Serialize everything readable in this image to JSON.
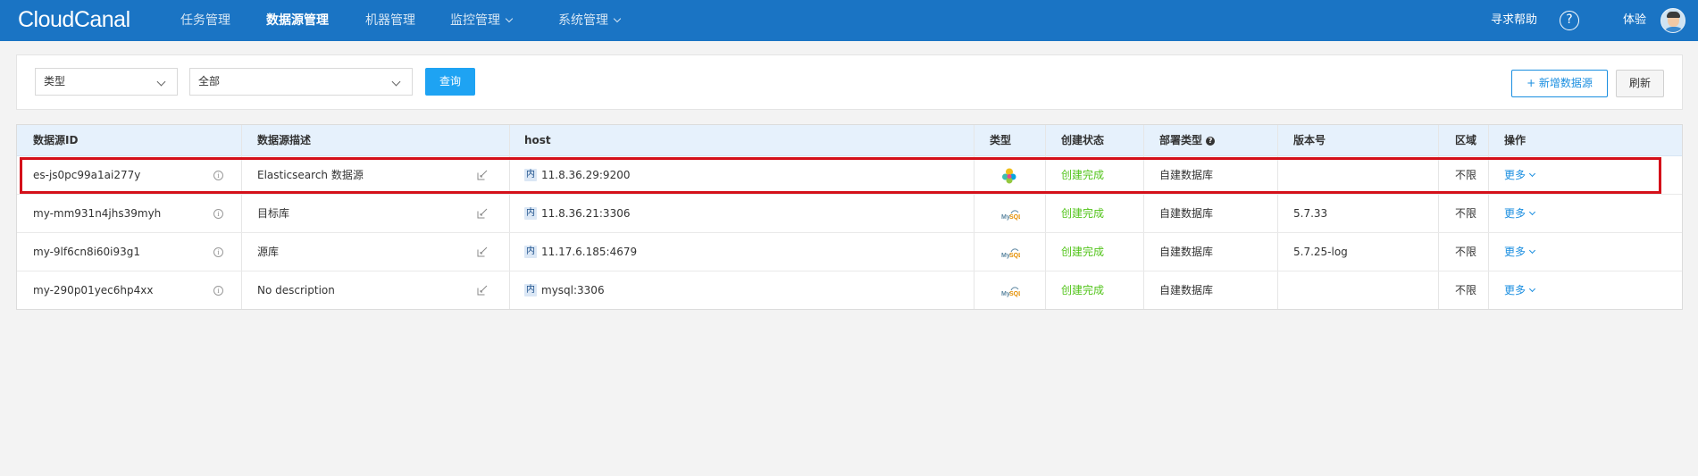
{
  "app": {
    "logo": "CloudCanal"
  },
  "nav": {
    "items": [
      {
        "label": "任务管理",
        "has_dropdown": false,
        "active": false
      },
      {
        "label": "数据源管理",
        "has_dropdown": false,
        "active": true
      },
      {
        "label": "机器管理",
        "has_dropdown": false,
        "active": false
      },
      {
        "label": "监控管理",
        "has_dropdown": true,
        "active": false
      },
      {
        "label": "系统管理",
        "has_dropdown": true,
        "active": false
      }
    ],
    "help_text": "寻求帮助",
    "help_icon": "question-circle-icon",
    "user": "体验"
  },
  "filters": {
    "type_select": "类型",
    "scope_select": "全部",
    "query_button": "查询",
    "add_button": "+ 新增数据源",
    "refresh_button": "刷新"
  },
  "table": {
    "columns": [
      "数据源ID",
      "数据源描述",
      "host",
      "类型",
      "创建状态",
      "部署类型",
      "版本号",
      "区域",
      "操作"
    ],
    "deploy_help_icon": "?",
    "inner_tag": "内",
    "rows": [
      {
        "id": "es-js0pc99a1ai277y",
        "desc": "Elasticsearch 数据源",
        "host": "11.8.36.29:9200",
        "type_icon": "elasticsearch-icon",
        "status": "创建完成",
        "deploy": "自建数据库",
        "version": "",
        "region": "不限",
        "action": "更多"
      },
      {
        "id": "my-mm931n4jhs39myh",
        "desc": "目标库",
        "host": "11.8.36.21:3306",
        "type_icon": "mysql-icon",
        "status": "创建完成",
        "deploy": "自建数据库",
        "version": "5.7.33",
        "region": "不限",
        "action": "更多"
      },
      {
        "id": "my-9lf6cn8i60i93g1",
        "desc": "源库",
        "host": "11.17.6.185:4679",
        "type_icon": "mysql-icon",
        "status": "创建完成",
        "deploy": "自建数据库",
        "version": "5.7.25-log",
        "region": "不限",
        "action": "更多"
      },
      {
        "id": "my-290p01yec6hp4xx",
        "desc": "No description",
        "host": "mysql:3306",
        "type_icon": "mysql-icon",
        "status": "创建完成",
        "deploy": "自建数据库",
        "version": "",
        "region": "不限",
        "action": "更多"
      }
    ]
  },
  "colors": {
    "topbar": "#1a74c4",
    "primary": "#1a8ee0",
    "query_button": "#1ea3f3",
    "status_ok": "#52c41a",
    "highlight": "#d4101a",
    "header_bg": "#e6f1fc"
  }
}
